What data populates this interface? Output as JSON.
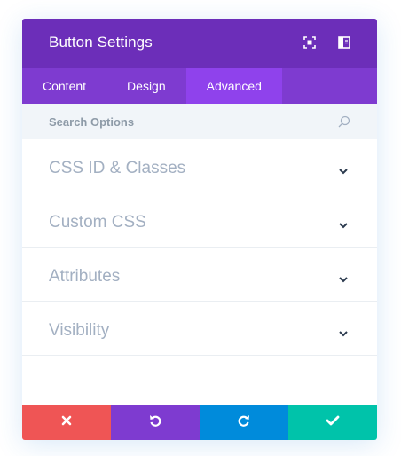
{
  "header": {
    "title": "Button Settings"
  },
  "tabs": [
    {
      "label": "Content"
    },
    {
      "label": "Design"
    },
    {
      "label": "Advanced"
    }
  ],
  "active_tab": "Advanced",
  "search": {
    "placeholder": "Search Options"
  },
  "toggles": [
    {
      "label": "CSS ID & Classes"
    },
    {
      "label": "Custom CSS"
    },
    {
      "label": "Attributes"
    },
    {
      "label": "Visibility"
    }
  ],
  "footer": {
    "buttons": [
      {
        "action": "discard",
        "icon": "close-icon",
        "color": "#ef5555"
      },
      {
        "action": "undo",
        "icon": "undo-icon",
        "color": "#7e3bd0"
      },
      {
        "action": "redo",
        "icon": "redo-icon",
        "color": "#008bdb"
      },
      {
        "action": "save",
        "icon": "check-icon",
        "color": "#00c3aa"
      }
    ]
  },
  "colors": {
    "header_bg": "#6c2eb9",
    "tabs_bg": "#7e3bd0",
    "active_tab_bg": "#8f42ec",
    "search_bg": "#f1f5f9",
    "toggle_text": "#a3b0c2",
    "chevron": "#2b3a4e"
  }
}
